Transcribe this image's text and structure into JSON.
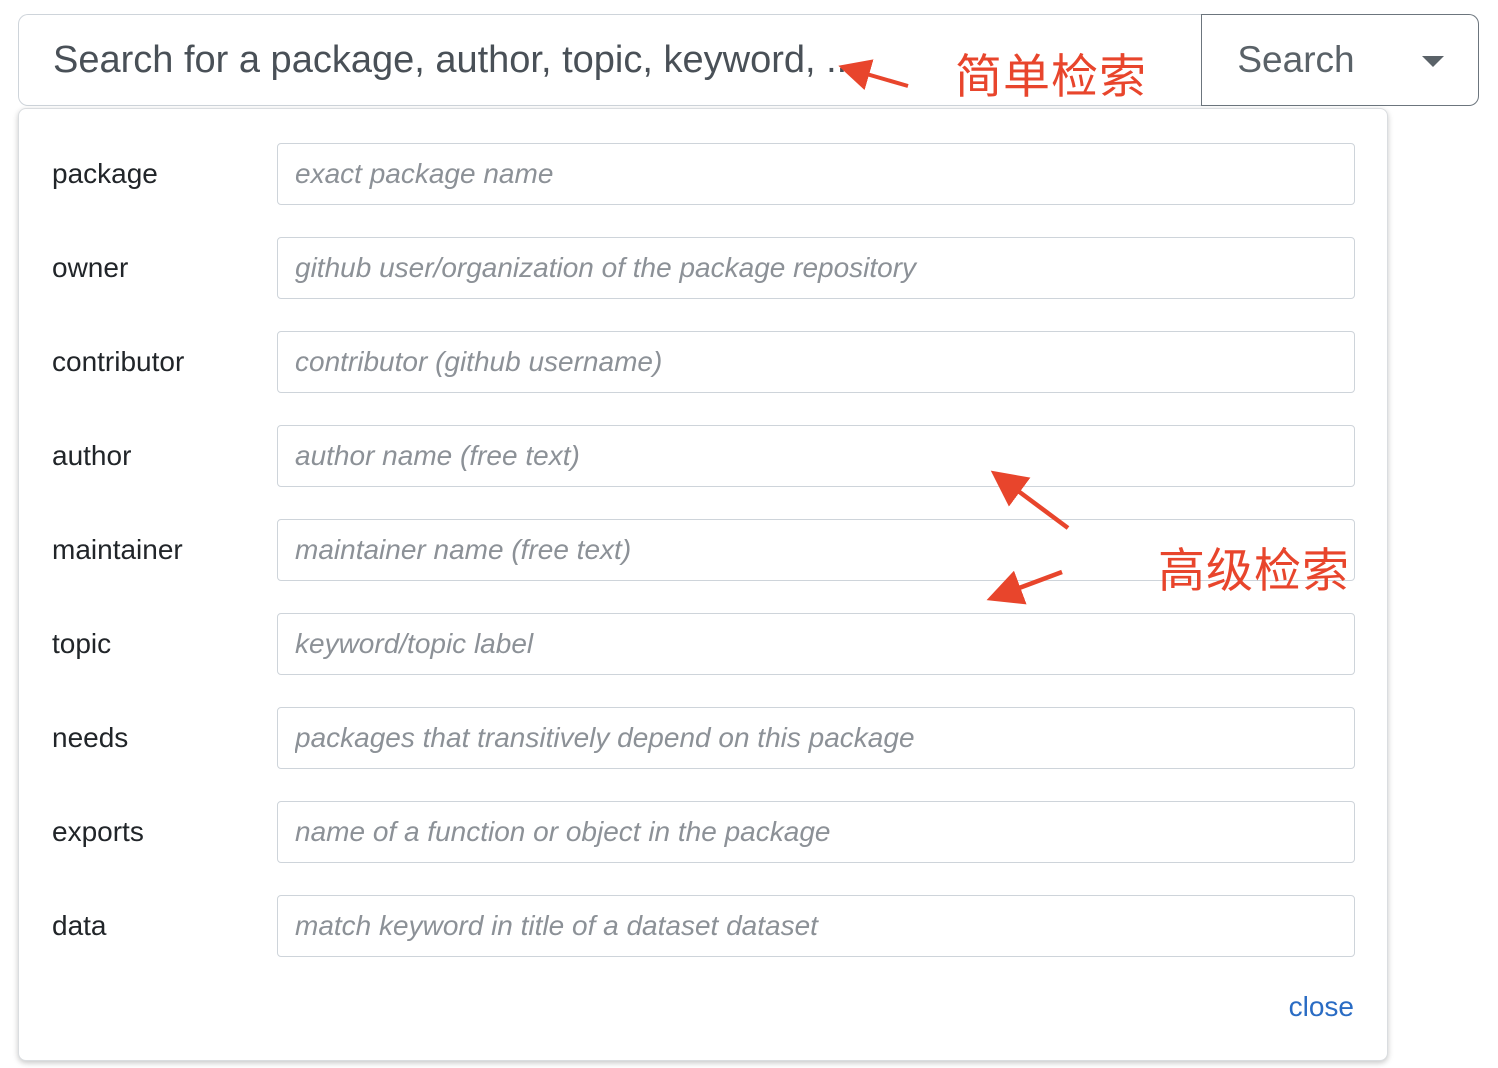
{
  "search": {
    "placeholder": "Search for a package, author, topic, keyword, ...",
    "button_label": "Search",
    "dropdown_icon": "caret-down-icon"
  },
  "annotations": {
    "simple_search": "简单检索",
    "advanced_search": "高级检索",
    "color": "#e8452c"
  },
  "advanced_fields": [
    {
      "label": "package",
      "placeholder": "exact package name"
    },
    {
      "label": "owner",
      "placeholder": "github user/organization of the package repository"
    },
    {
      "label": "contributor",
      "placeholder": "contributor (github username)"
    },
    {
      "label": "author",
      "placeholder": "author name (free text)"
    },
    {
      "label": "maintainer",
      "placeholder": "maintainer name (free text)"
    },
    {
      "label": "topic",
      "placeholder": "keyword/topic label"
    },
    {
      "label": "needs",
      "placeholder": "packages that transitively depend on this package"
    },
    {
      "label": "exports",
      "placeholder": "name of a function or object in the package"
    },
    {
      "label": "data",
      "placeholder": "match keyword in title of a dataset dataset"
    }
  ],
  "close_label": "close",
  "colors": {
    "link": "#2a6cc4",
    "placeholder": "#8c9197",
    "border": "#ced4da"
  }
}
